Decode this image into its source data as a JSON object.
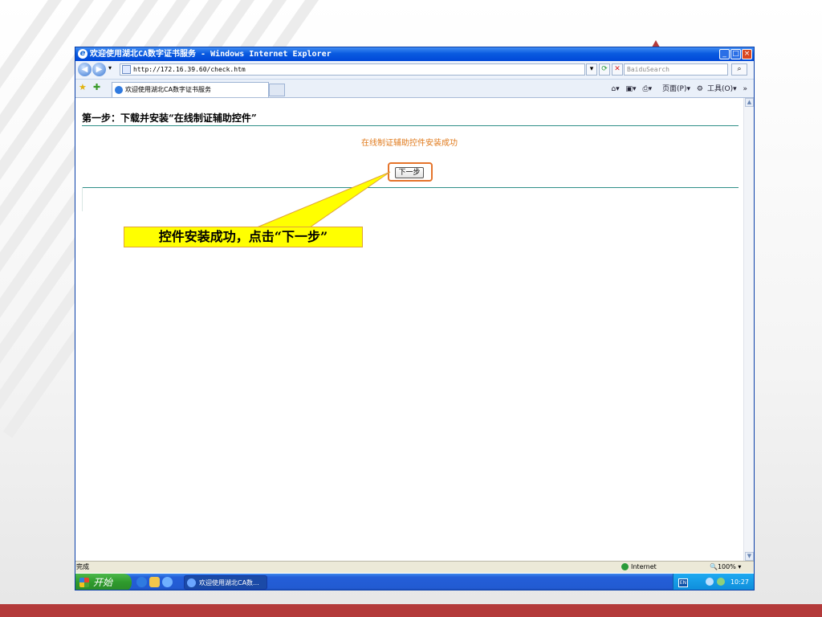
{
  "window": {
    "title": "欢迎使用湖北CA数字证书服务 - Windows Internet Explorer",
    "address_url": "http://172.16.39.60/check.htm",
    "search_placeholder": "BaiduSearch",
    "tab_label": "欢迎使用湖北CA数字证书服务",
    "command_bar": {
      "page_label": "页面(P)",
      "tools_label": "工具(O)"
    }
  },
  "page": {
    "step_title": "第一步：下载并安装“在线制证辅助控件”",
    "success_message": "在线制证辅助控件安装成功",
    "next_button_label": "下一步"
  },
  "callout": {
    "text": "控件安装成功，点击“下一步”"
  },
  "statusbar": {
    "status": "完成",
    "zone": "Internet",
    "zoom": "100%"
  },
  "taskbar": {
    "start_label": "开始",
    "task_label": "欢迎使用湖北CA数...",
    "lang": "EN",
    "clock": "10:27"
  },
  "colors": {
    "accent_orange": "#e07a1c",
    "divider_teal": "#2f8f88",
    "callout_yellow": "#ffff00",
    "xp_blue": "#0048d8",
    "slide_bar": "#b33a3a"
  }
}
